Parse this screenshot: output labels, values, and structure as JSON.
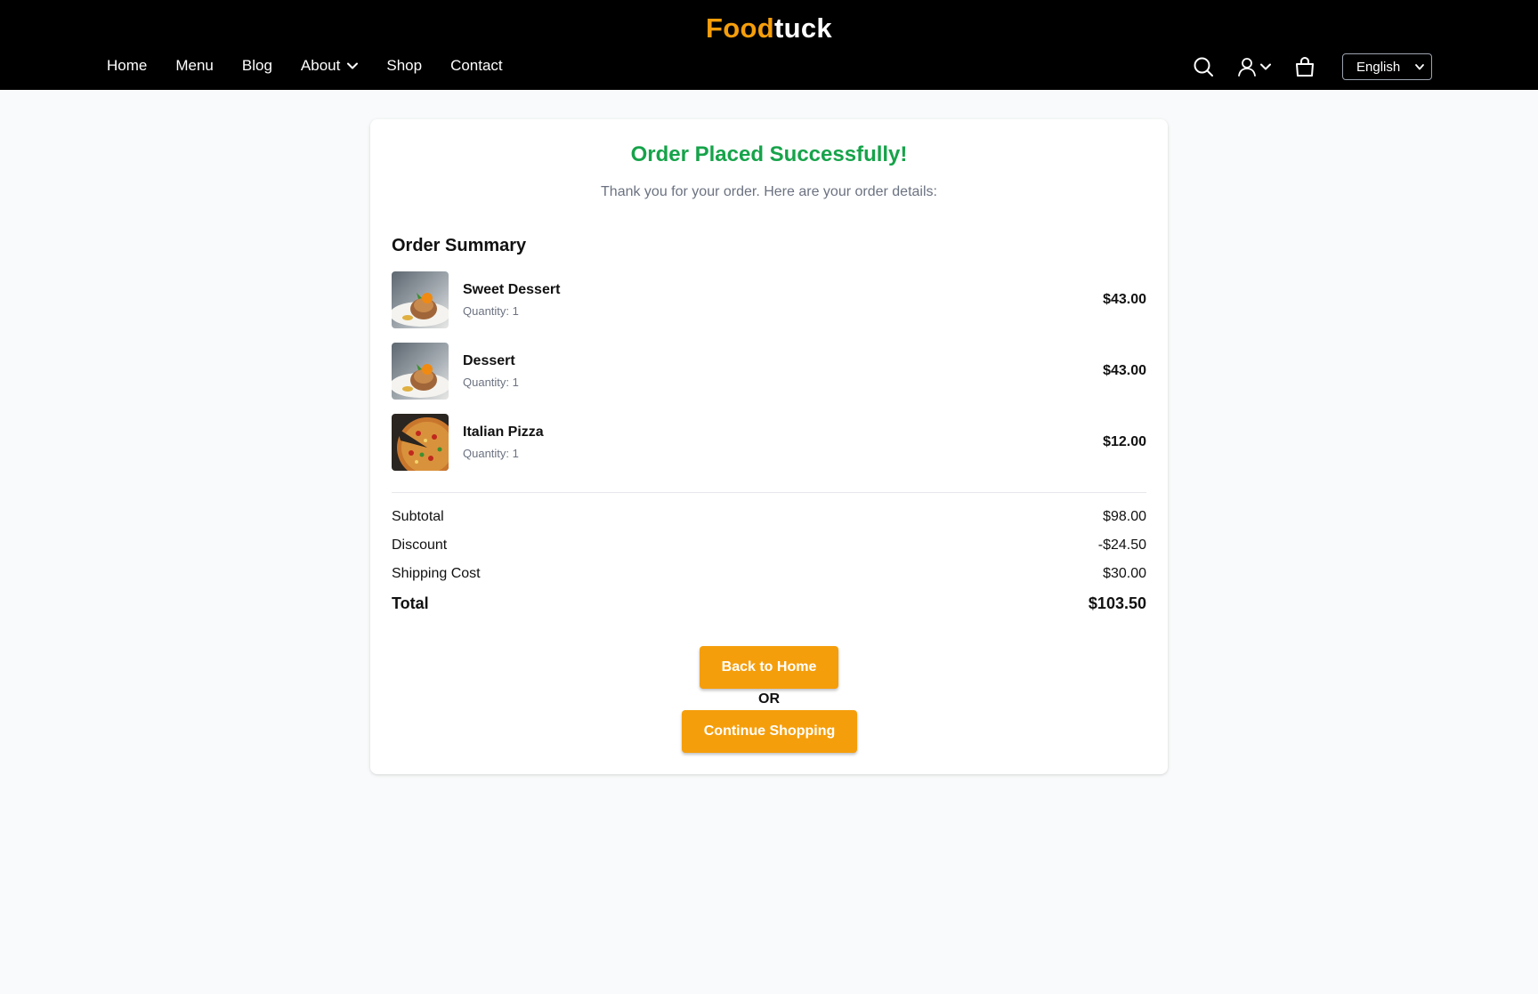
{
  "header": {
    "logo_part1": "Food",
    "logo_part2": "tuck",
    "nav": [
      {
        "label": "Home"
      },
      {
        "label": "Menu"
      },
      {
        "label": "Blog"
      },
      {
        "label": "About"
      },
      {
        "label": "Shop"
      },
      {
        "label": "Contact"
      }
    ],
    "language": "English",
    "icons": [
      "search-icon",
      "user-icon",
      "chevron-down-icon",
      "shopping-bag-icon"
    ]
  },
  "confirmation": {
    "title": "Order Placed Successfully!",
    "message": "Thank you for your order. Here are your order details:",
    "summary_title": "Order Summary",
    "items": [
      {
        "name": "Sweet Dessert",
        "quantity": "Quantity: 1",
        "price": "$43.00",
        "image": "dessert-image"
      },
      {
        "name": "Dessert",
        "quantity": "Quantity: 1",
        "price": "$43.00",
        "image": "dessert-image"
      },
      {
        "name": "Italian Pizza",
        "quantity": "Quantity: 1",
        "price": "$12.00",
        "image": "pizza-image"
      }
    ],
    "totals": {
      "subtotal_label": "Subtotal",
      "subtotal": "$98.00",
      "discount_label": "Discount",
      "discount": "-$24.50",
      "shipping_label": "Shipping Cost",
      "shipping": "$30.00",
      "total_label": "Total",
      "total": "$103.50"
    },
    "back_home_label": "Back to Home",
    "or_label": "OR",
    "continue_label": "Continue Shopping"
  },
  "colors": {
    "accent": "#f59e0b",
    "success": "#16a34a",
    "header_bg": "#000000",
    "page_bg": "#f9fafb"
  }
}
